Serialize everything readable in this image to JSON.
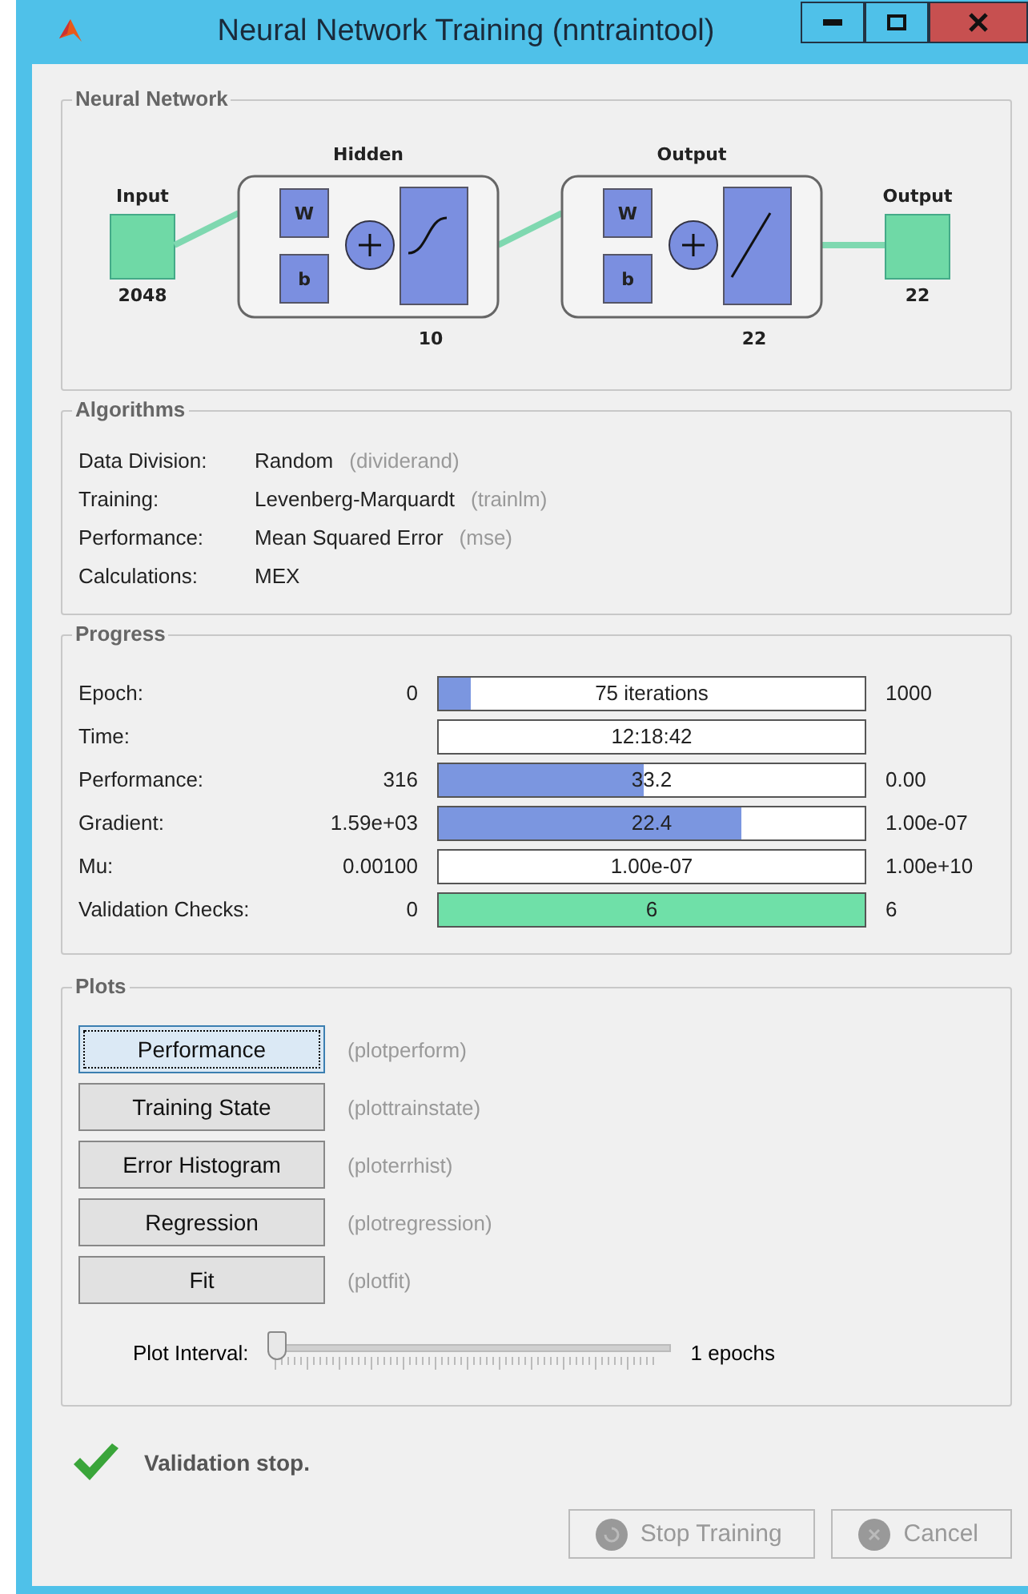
{
  "window": {
    "title": "Neural Network Training (nntraintool)"
  },
  "network": {
    "title": "Neural Network",
    "input_label": "Input",
    "input_size": "2048",
    "output_label": "Output",
    "output_size": "22",
    "layers": [
      {
        "title": "Hidden",
        "size": "10",
        "weight": "W",
        "bias": "b",
        "kind": "sigmoid"
      },
      {
        "title": "Output",
        "size": "22",
        "weight": "W",
        "bias": "b",
        "kind": "linear"
      }
    ]
  },
  "algorithms": {
    "title": "Algorithms",
    "rows": [
      {
        "label": "Data Division:",
        "value": "Random",
        "hint": "(dividerand)"
      },
      {
        "label": "Training:",
        "value": "Levenberg-Marquardt",
        "hint": "(trainlm)"
      },
      {
        "label": "Performance:",
        "value": "Mean Squared Error",
        "hint": "(mse)"
      },
      {
        "label": "Calculations:",
        "value": "MEX"
      }
    ]
  },
  "progress": {
    "title": "Progress",
    "rows": [
      {
        "label": "Epoch:",
        "start": "0",
        "reading": "75 iterations",
        "end": "1000",
        "level": 0.075,
        "kind": "progress"
      },
      {
        "label": "Time:",
        "reading": "12:18:42"
      },
      {
        "label": "Performance:",
        "start": "316",
        "reading": "33.2",
        "end": "0.00",
        "level": 0.48,
        "kind": "progress"
      },
      {
        "label": "Gradient:",
        "start": "1.59e+03",
        "reading": "22.4",
        "end": "1.00e-07",
        "level": 0.71,
        "kind": "progress"
      },
      {
        "label": "Mu:",
        "start": "0.00100",
        "reading": "1.00e-07",
        "end": "1.00e+10"
      },
      {
        "label": "Validation Checks:",
        "start": "0",
        "reading": "6",
        "end": "6",
        "level": 1,
        "kind": "checks"
      }
    ]
  },
  "plots": {
    "title": "Plots",
    "buttons": [
      {
        "label": "Performance",
        "hint": "(plotperform)",
        "selected": true
      },
      {
        "label": "Training State",
        "hint": "(plottrainstate)",
        "selected": false
      },
      {
        "label": "Error Histogram",
        "hint": "(ploterrhist)",
        "selected": false
      },
      {
        "label": "Regression",
        "hint": "(plotregression)",
        "selected": false
      },
      {
        "label": "Fit",
        "hint": "(plotfit)",
        "selected": false
      }
    ],
    "interval": {
      "label": "Plot Interval:",
      "level": 0,
      "reading": "1 epochs"
    }
  },
  "status": "Validation stop.",
  "actions": [
    {
      "label": "Stop Training",
      "disabled": true,
      "kind": "stop"
    },
    {
      "label": "Cancel",
      "disabled": true,
      "kind": "cancel"
    }
  ]
}
